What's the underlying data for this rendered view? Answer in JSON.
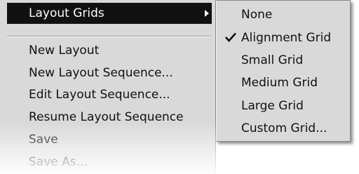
{
  "main_menu": {
    "items": [
      {
        "label": "Layout Grids",
        "highlighted": true,
        "has_submenu": true
      },
      {
        "label": "New Layout"
      },
      {
        "label": "New Layout Sequence..."
      },
      {
        "label": "Edit Layout Sequence..."
      },
      {
        "label": "Resume Layout Sequence"
      },
      {
        "label": "Save"
      },
      {
        "label": "Save As..."
      }
    ]
  },
  "submenu": {
    "items": [
      {
        "label": "None"
      },
      {
        "label": "Alignment Grid",
        "checked": true
      },
      {
        "label": "Small Grid"
      },
      {
        "label": "Medium Grid"
      },
      {
        "label": "Large Grid"
      },
      {
        "label": "Custom Grid..."
      }
    ]
  },
  "icons": {
    "submenu_arrow": "chevron-right-icon",
    "checkmark": "check-icon"
  },
  "colors": {
    "menu_background": "#d9d9d9",
    "highlight_background": "#111111",
    "highlight_text": "#ffffff",
    "text": "#111111"
  }
}
